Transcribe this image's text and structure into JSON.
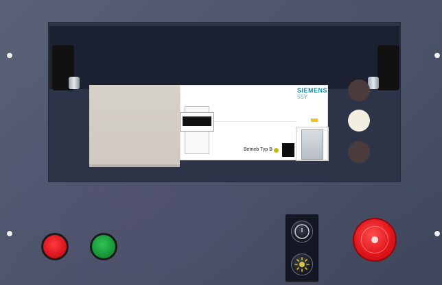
{
  "module": {
    "brand": "SIEMENS",
    "model": "5SY",
    "status_label": "Betrieb Typ B"
  },
  "colors": {
    "panel": "#4c546a",
    "red_button": "#e3131b",
    "green_button": "#18a33b",
    "estop": "#e0141a",
    "indicator_on": "#f3efe0",
    "indicator_off": "#4a3b3d"
  },
  "controls": {
    "left_buttons": [
      "red",
      "green"
    ],
    "knobs": [
      "power-knob",
      "brightness-knob"
    ],
    "indicators": [
      "off",
      "on",
      "off"
    ]
  }
}
